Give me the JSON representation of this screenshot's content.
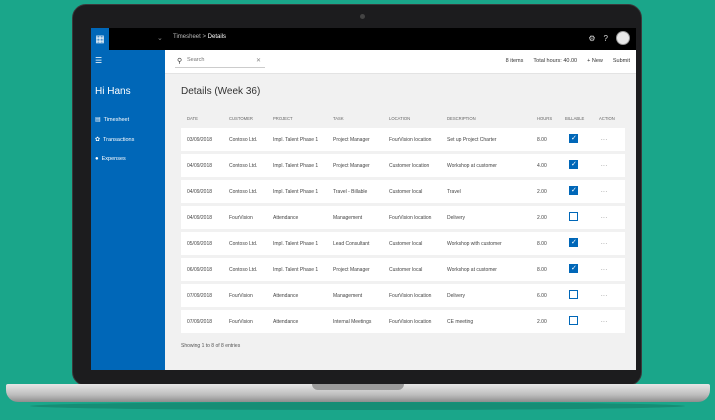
{
  "breadcrumb": {
    "parent": "Timesheet",
    "separator": ">",
    "current": "Details"
  },
  "topbar": {
    "settings_icon": "gear-icon",
    "help_label": "?"
  },
  "sidebar": {
    "greeting": "Hi Hans",
    "items": [
      {
        "label": "Timesheet",
        "icon": "calendar-icon"
      },
      {
        "label": "Transactions",
        "icon": "gear-icon"
      },
      {
        "label": "Expenses",
        "icon": "drop-icon"
      }
    ]
  },
  "command_bar": {
    "search_placeholder": "Search",
    "items_count": "8 items",
    "total_hours": "Total hours: 40.00",
    "new_label": "+ New",
    "submit_label": "Submit"
  },
  "page_title": "Details (Week 36)",
  "table": {
    "columns": [
      "Date",
      "Customer",
      "Project",
      "Task",
      "Location",
      "Description",
      "Hours",
      "Billable",
      "Action"
    ],
    "rows": [
      {
        "date": "03/09/2018",
        "customer": "Contoso Ltd.",
        "project": "Impl. Talent Phase 1",
        "task": "Project Manager",
        "location": "FourVision location",
        "description": "Set up Project Charter",
        "hours": "8.00",
        "billable": true,
        "action": "···"
      },
      {
        "date": "04/09/2018",
        "customer": "Contoso Ltd.",
        "project": "Impl. Talent Phase 1",
        "task": "Project Manager",
        "location": "Customer location",
        "description": "Workshop at customer",
        "hours": "4.00",
        "billable": true,
        "action": "···"
      },
      {
        "date": "04/09/2018",
        "customer": "Contoso Ltd.",
        "project": "Impl. Talent Phase 1",
        "task": "Travel - Billable",
        "location": "Customer local",
        "description": "Travel",
        "hours": "2.00",
        "billable": true,
        "action": "···"
      },
      {
        "date": "04/09/2018",
        "customer": "FourVision",
        "project": "Attendance",
        "task": "Management",
        "location": "FourVision location",
        "description": "Delivery",
        "hours": "2.00",
        "billable": false,
        "action": "···"
      },
      {
        "date": "05/09/2018",
        "customer": "Contoso Ltd.",
        "project": "Impl. Talent Phase 1",
        "task": "Lead Consultant",
        "location": "Customer local",
        "description": "Workshop with customer",
        "hours": "8.00",
        "billable": true,
        "action": "···"
      },
      {
        "date": "06/09/2018",
        "customer": "Contoso Ltd.",
        "project": "Impl. Talent Phase 1",
        "task": "Project Manager",
        "location": "Customer local",
        "description": "Workshop at customer",
        "hours": "8.00",
        "billable": true,
        "action": "···"
      },
      {
        "date": "07/09/2018",
        "customer": "FourVision",
        "project": "Attendance",
        "task": "Management",
        "location": "FourVision location",
        "description": "Delivery",
        "hours": "6.00",
        "billable": false,
        "action": "···"
      },
      {
        "date": "07/09/2018",
        "customer": "FourVision",
        "project": "Attendance",
        "task": "Internal Meetings",
        "location": "FourVision location",
        "description": "CE meeting",
        "hours": "2.00",
        "billable": false,
        "action": "···"
      }
    ]
  },
  "footer_text": "Showing 1 to 8 of 8 entries",
  "colors": {
    "accent": "#0067b8",
    "background": "#1aa68a",
    "topbar": "#000000"
  }
}
